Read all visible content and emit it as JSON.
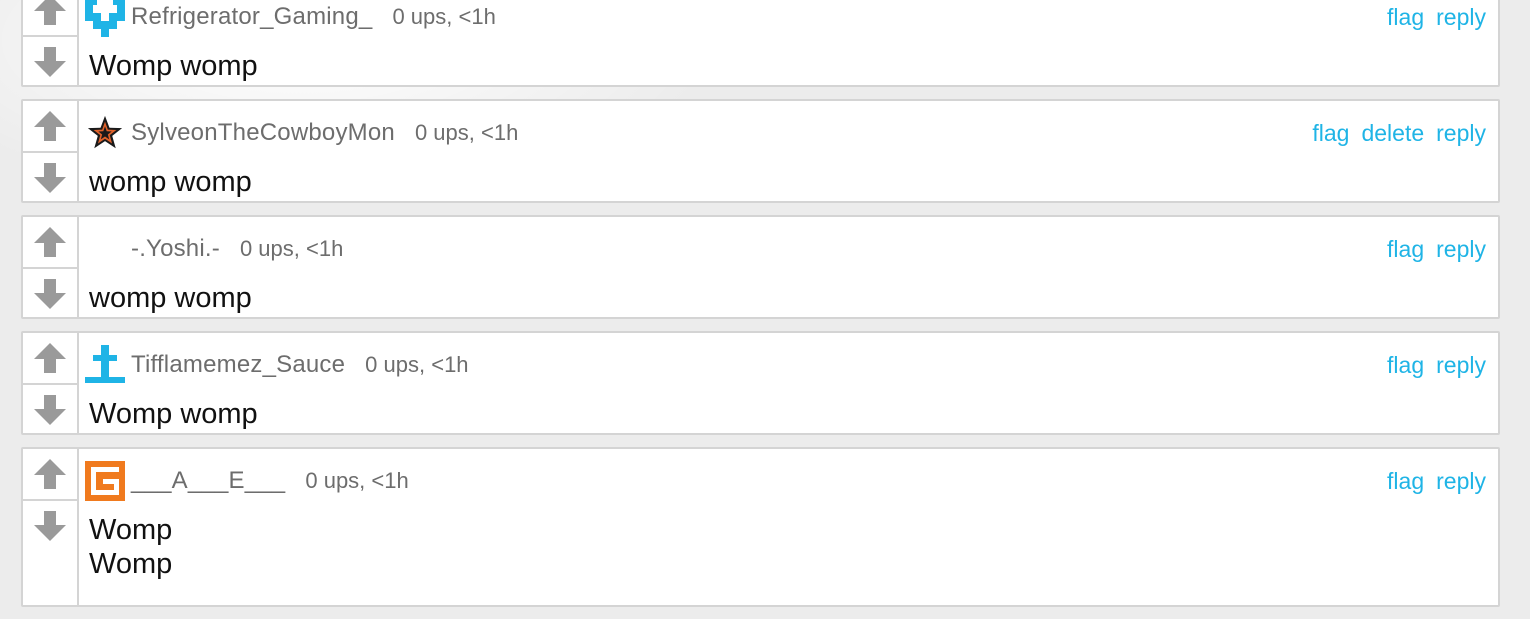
{
  "comments": [
    {
      "username": "Refrigerator_Gaming_",
      "meta": "0 ups, <1h",
      "text": "Womp womp",
      "avatar": "pixel-heart-icon",
      "actions": [
        "flag",
        "reply"
      ]
    },
    {
      "username": "SylveonTheCowboyMon",
      "meta": "0 ups, <1h",
      "text": "womp womp",
      "avatar": "sheriff-star-icon",
      "actions": [
        "flag",
        "delete",
        "reply"
      ]
    },
    {
      "username": "-.Yoshi.-",
      "meta": "0 ups, <1h",
      "text": "womp womp",
      "avatar": "none",
      "actions": [
        "flag",
        "reply"
      ]
    },
    {
      "username": "Tifflamemez_Sauce",
      "meta": "0 ups, <1h",
      "text": "Womp womp",
      "avatar": "pixel-cross-icon",
      "actions": [
        "flag",
        "reply"
      ]
    },
    {
      "username": "___A___E___",
      "meta": "0 ups, <1h",
      "text_lines": [
        "Womp",
        "Womp"
      ],
      "avatar": "pixel-g-icon",
      "actions": [
        "flag",
        "reply"
      ]
    }
  ],
  "colors": {
    "link": "#1fb4e6",
    "meta": "#6d6d6d",
    "vote_arrow": "#9a9a9a",
    "border": "#d4d4d4"
  }
}
